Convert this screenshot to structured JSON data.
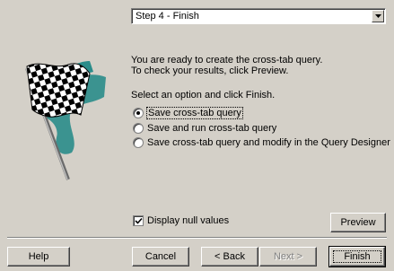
{
  "step_selector": {
    "value": "Step 4 - Finish"
  },
  "message": {
    "line1": "You are ready to create the cross-tab query.",
    "line2": "To check your results, click Preview.",
    "prompt": "Select an option and click Finish."
  },
  "options": [
    {
      "label": "Save cross-tab query",
      "selected": true
    },
    {
      "label": "Save and run cross-tab query",
      "selected": false
    },
    {
      "label": "Save cross-tab query and modify in the Query Designer",
      "selected": false
    }
  ],
  "display_null": {
    "label": "Display null values",
    "checked": true
  },
  "buttons": {
    "preview": "Preview",
    "help": "Help",
    "cancel": "Cancel",
    "back": "< Back",
    "next": "Next >",
    "finish": "Finish"
  },
  "colors": {
    "flag_teal": "#2a8c8a",
    "face": "#d4d0c8"
  },
  "icons": {
    "wizard_image": "checkered-flag-icon"
  }
}
